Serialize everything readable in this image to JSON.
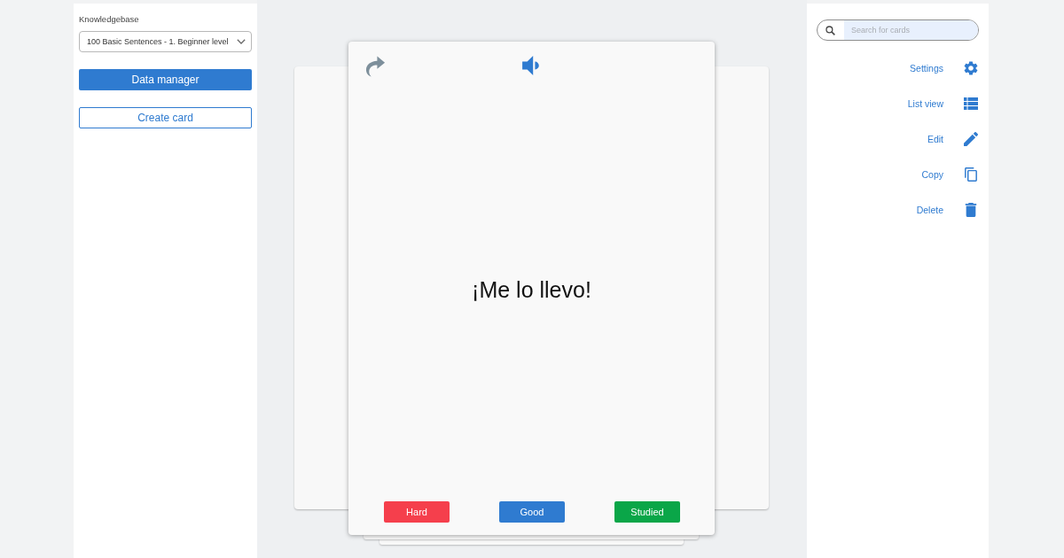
{
  "sidebar": {
    "label": "Knowledgebase",
    "select": {
      "value": "100 Basic Sentences - 1. Beginner level"
    },
    "buttons": [
      {
        "label": "Data manager",
        "kind": "primary"
      },
      {
        "label": "Create card",
        "kind": "outline"
      }
    ]
  },
  "card": {
    "text": "¡Me lo llevo!",
    "answers": [
      {
        "label": "Hard",
        "color": "#f53f4c"
      },
      {
        "label": "Good",
        "color": "#2f7bd0"
      },
      {
        "label": "Studied",
        "color": "#0aa648"
      }
    ]
  },
  "search": {
    "placeholder": "Search for cards"
  },
  "actions": [
    {
      "label": "Settings"
    },
    {
      "label": "List view"
    },
    {
      "label": "Edit"
    },
    {
      "label": "Copy"
    },
    {
      "label": "Delete"
    }
  ]
}
